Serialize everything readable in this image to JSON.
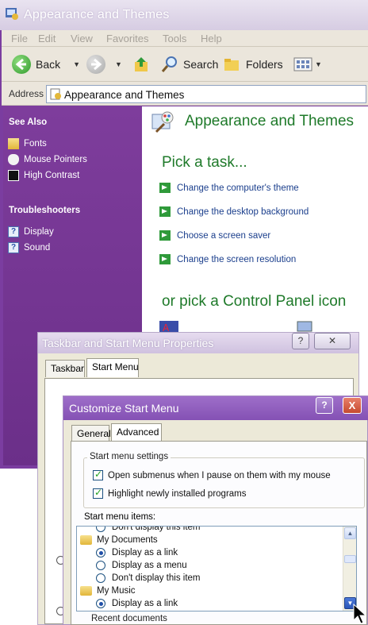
{
  "main_window": {
    "title": "Appearance and Themes",
    "menu": [
      "File",
      "Edit",
      "View",
      "Favorites",
      "Tools",
      "Help"
    ],
    "toolbar": {
      "back_label": "Back",
      "search_label": "Search",
      "folders_label": "Folders"
    },
    "address": {
      "label": "Address",
      "value": "Appearance and Themes"
    },
    "sidebar": {
      "see_also_heading": "See Also",
      "see_also": [
        "Fonts",
        "Mouse Pointers",
        "High Contrast"
      ],
      "troubleshooters_heading": "Troubleshooters",
      "troubleshooters": [
        "Display",
        "Sound"
      ]
    },
    "content": {
      "title": "Appearance and Themes",
      "pick_task": "Pick a task...",
      "tasks": [
        "Change the computer's theme",
        "Change the desktop background",
        "Choose a screen saver",
        "Change the screen resolution"
      ],
      "pick_icon": "or pick a Control Panel icon"
    }
  },
  "taskbar_dialog": {
    "title": "Taskbar and Start Menu Properties",
    "tabs": [
      "Taskbar",
      "Start Menu"
    ],
    "selected_tab": "Start Menu",
    "help_label": "?",
    "close_label": "✕"
  },
  "customize_dialog": {
    "title": "Customize Start Menu",
    "help_label": "?",
    "close_label": "X",
    "tabs": [
      "General",
      "Advanced"
    ],
    "selected_tab": "Advanced",
    "settings_group": "Start menu settings",
    "checkboxes": [
      {
        "label": "Open submenus when I pause on them with my mouse",
        "checked": true
      },
      {
        "label": "Highlight newly installed programs",
        "checked": true
      }
    ],
    "items_label": "Start menu items:",
    "items": [
      {
        "kind": "radio",
        "label": "Don't display this item",
        "selected": false
      },
      {
        "kind": "folder",
        "label": "My Documents"
      },
      {
        "kind": "radio",
        "label": "Display as a link",
        "selected": true
      },
      {
        "kind": "radio",
        "label": "Display as a menu",
        "selected": false
      },
      {
        "kind": "radio",
        "label": "Don't display this item",
        "selected": false
      },
      {
        "kind": "folder",
        "label": "My Music"
      },
      {
        "kind": "radio",
        "label": "Display as a link",
        "selected": true
      }
    ],
    "recent_group": "Recent documents"
  },
  "colors": {
    "sidebar_purple": "#7b3da0",
    "heading_green": "#1f7a2a",
    "link_blue": "#1a3e8c",
    "dialog_title_purple": "#8451b4"
  }
}
